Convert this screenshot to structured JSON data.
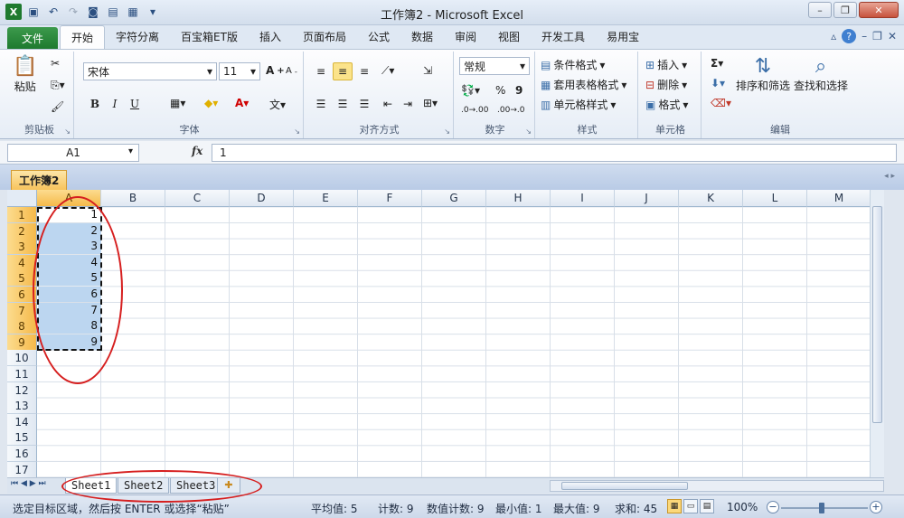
{
  "window": {
    "title": "工作簿2 - Microsoft Excel",
    "app_icon": "X"
  },
  "ribbon_tabs": {
    "file": "文件",
    "items": [
      "开始",
      "字符分离",
      "百宝箱ET版",
      "插入",
      "页面布局",
      "公式",
      "数据",
      "审阅",
      "视图",
      "开发工具",
      "易用宝"
    ],
    "active": "开始"
  },
  "ribbon": {
    "clipboard": {
      "paste": "粘贴",
      "label": "剪贴板"
    },
    "font": {
      "name": "宋体",
      "size": "11",
      "bold": "B",
      "italic": "I",
      "underline": "U",
      "label": "字体"
    },
    "alignment": {
      "label": "对齐方式"
    },
    "number": {
      "format": "常规",
      "percent": "%",
      "comma": "9",
      "label": "数字"
    },
    "styles": {
      "conditional": "条件格式",
      "table": "套用表格格式",
      "cell": "单元格样式",
      "label": "样式"
    },
    "cells": {
      "insert": "插入",
      "delete": "删除",
      "format": "格式",
      "label": "单元格"
    },
    "editing": {
      "sort": "排序和筛选",
      "find": "查找和选择",
      "label": "编辑"
    }
  },
  "formula_bar": {
    "name_box": "A1",
    "fx": "fx",
    "value": "1"
  },
  "workbook_tab": "工作簿2",
  "columns": [
    "A",
    "B",
    "C",
    "D",
    "E",
    "F",
    "G",
    "H",
    "I",
    "J",
    "K",
    "L",
    "M"
  ],
  "rows": [
    "1",
    "2",
    "3",
    "4",
    "5",
    "6",
    "7",
    "8",
    "9",
    "10",
    "11",
    "12",
    "13",
    "14",
    "15",
    "16",
    "17"
  ],
  "cells_a": [
    "1",
    "2",
    "3",
    "4",
    "5",
    "6",
    "7",
    "8",
    "9"
  ],
  "sheets": [
    "Sheet1",
    "Sheet2",
    "Sheet3"
  ],
  "status": {
    "message": "选定目标区域，然后按 ENTER 或选择“粘贴”",
    "average": "平均值: 5",
    "count": "计数: 9",
    "numeric_count": "数值计数: 9",
    "min": "最小值: 1",
    "max": "最大值: 9",
    "sum": "求和: 45",
    "zoom": "100%"
  },
  "colors": {
    "selection": "#bcd6f0",
    "annotation": "#d61f1f",
    "file_tab": "#1e7a2f"
  }
}
